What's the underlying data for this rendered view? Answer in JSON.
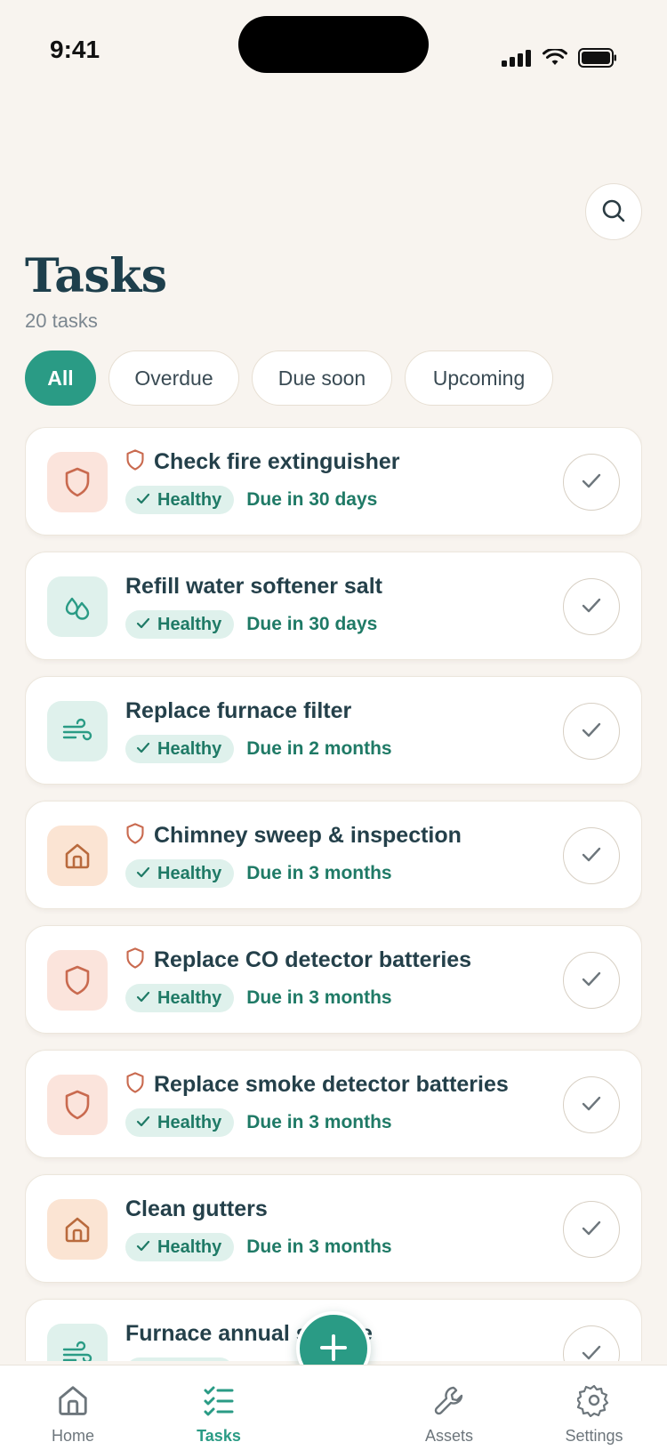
{
  "status_bar": {
    "time": "9:41"
  },
  "header": {
    "title": "Tasks",
    "count": "20 tasks"
  },
  "filters": [
    {
      "label": "All",
      "active": true
    },
    {
      "label": "Overdue",
      "active": false
    },
    {
      "label": "Due soon",
      "active": false
    },
    {
      "label": "Upcoming",
      "active": false
    }
  ],
  "tasks": [
    {
      "title": "Check fire extinguisher",
      "status": "Healthy",
      "due": "Due in 30 days",
      "icon": "shield-icon",
      "tone": "red",
      "safety": true
    },
    {
      "title": "Refill water softener salt",
      "status": "Healthy",
      "due": "Due in 30 days",
      "icon": "droplets-icon",
      "tone": "teal",
      "safety": false
    },
    {
      "title": "Replace furnace filter",
      "status": "Healthy",
      "due": "Due in 2 months",
      "icon": "wind-icon",
      "tone": "teal",
      "safety": false
    },
    {
      "title": "Chimney sweep & inspection",
      "status": "Healthy",
      "due": "Due in 3 months",
      "icon": "home-icon",
      "tone": "orange",
      "safety": true
    },
    {
      "title": "Replace CO detector batteries",
      "status": "Healthy",
      "due": "Due in 3 months",
      "icon": "shield-icon",
      "tone": "red",
      "safety": true
    },
    {
      "title": "Replace smoke detector batteries",
      "status": "Healthy",
      "due": "Due in 3 months",
      "icon": "shield-icon",
      "tone": "red",
      "safety": true
    },
    {
      "title": "Clean gutters",
      "status": "Healthy",
      "due": "Due in 3 months",
      "icon": "home-icon",
      "tone": "orange",
      "safety": false
    },
    {
      "title": "Furnace annual service",
      "status": "Healthy",
      "due": "",
      "icon": "wind-icon",
      "tone": "teal",
      "safety": false
    }
  ],
  "tab_bar": {
    "home": "Home",
    "tasks": "Tasks",
    "assets": "Assets",
    "settings": "Settings",
    "active": "tasks"
  },
  "colors": {
    "accent": "#2a9b85",
    "background": "#f8f4ef",
    "title": "#1e3f4c",
    "safety": "#c96a4f",
    "home_tone": "#b96a3d"
  }
}
